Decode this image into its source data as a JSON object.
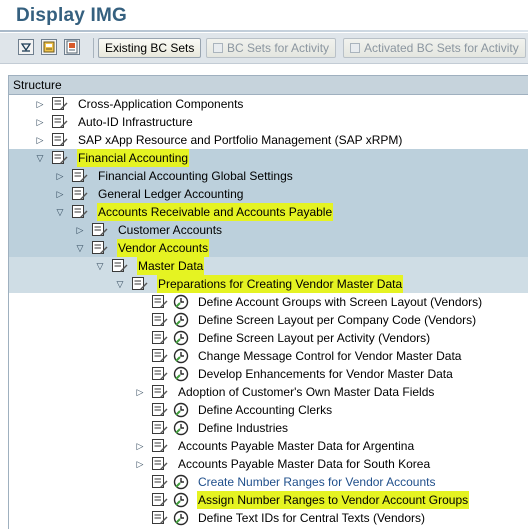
{
  "window": {
    "title": "Display IMG"
  },
  "toolbar": {
    "icons": [
      "collapse-icon",
      "where-used-icon",
      "release-notes-icon"
    ],
    "buttons": [
      {
        "label": "Existing BC Sets",
        "enabled": true
      },
      {
        "label": "BC Sets for Activity",
        "enabled": false
      },
      {
        "label": "Activated BC Sets for Activity",
        "enabled": false
      }
    ]
  },
  "tree": {
    "header": "Structure",
    "rows": [
      {
        "label": "Cross-Application Components",
        "expander": "collapsed",
        "clock": false
      },
      {
        "label": "Auto-ID Infrastructure",
        "expander": "collapsed",
        "clock": false
      },
      {
        "label": "SAP xApp Resource and Portfolio Management (SAP xRPM)",
        "expander": "collapsed",
        "clock": false
      },
      {
        "label": "Financial Accounting",
        "expander": "expanded",
        "clock": false,
        "highlight": true
      },
      {
        "label": "Financial Accounting Global Settings",
        "expander": "collapsed",
        "clock": false
      },
      {
        "label": "General Ledger Accounting",
        "expander": "collapsed",
        "clock": false
      },
      {
        "label": "Accounts Receivable and Accounts Payable",
        "expander": "expanded",
        "clock": false,
        "highlight": true
      },
      {
        "label": "Customer Accounts",
        "expander": "collapsed",
        "clock": false
      },
      {
        "label": "Vendor Accounts",
        "expander": "expanded",
        "clock": false,
        "highlight": true
      },
      {
        "label": "Master Data",
        "expander": "expanded",
        "clock": false,
        "highlight": true
      },
      {
        "label": "Preparations for Creating Vendor Master Data",
        "expander": "expanded",
        "clock": false,
        "highlight": true
      },
      {
        "label": "Define Account Groups with Screen Layout (Vendors)",
        "expander": "none",
        "clock": true
      },
      {
        "label": "Define Screen Layout per Company Code (Vendors)",
        "expander": "none",
        "clock": true
      },
      {
        "label": "Define Screen Layout per Activity (Vendors)",
        "expander": "none",
        "clock": true
      },
      {
        "label": "Change Message Control for Vendor Master Data",
        "expander": "none",
        "clock": true
      },
      {
        "label": "Develop Enhancements for Vendor Master Data",
        "expander": "none",
        "clock": true
      },
      {
        "label": "Adoption of Customer's Own Master Data Fields",
        "expander": "collapsed",
        "clock": false
      },
      {
        "label": "Define Accounting Clerks",
        "expander": "none",
        "clock": true
      },
      {
        "label": "Define Industries",
        "expander": "none",
        "clock": true
      },
      {
        "label": "Accounts Payable Master Data for Argentina",
        "expander": "collapsed",
        "clock": false
      },
      {
        "label": "Accounts Payable Master Data for South Korea",
        "expander": "collapsed",
        "clock": false
      },
      {
        "label": "Create Number Ranges for Vendor Accounts",
        "expander": "none",
        "clock": true,
        "link": true
      },
      {
        "label": "Assign Number Ranges to Vendor Account Groups",
        "expander": "none",
        "clock": true,
        "highlight": true
      },
      {
        "label": "Define Text IDs for Central Texts (Vendors)",
        "expander": "none",
        "clock": true
      }
    ]
  },
  "colors": {
    "title": "#35607f",
    "toolbar": "#dfe5ea",
    "band": "#bcd0dc",
    "highlight": "#e5f322",
    "link": "#1f4f8b"
  }
}
